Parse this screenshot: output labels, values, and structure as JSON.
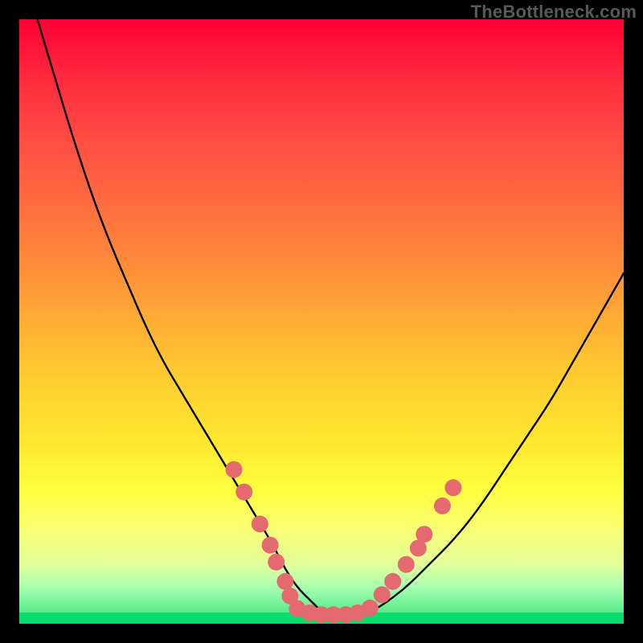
{
  "watermark": "TheBottleneck.com",
  "colors": {
    "dot_fill": "#e46a6f",
    "dot_stroke": "#d14e55",
    "curve": "#000000"
  },
  "chart_data": {
    "type": "line",
    "title": "",
    "xlabel": "",
    "ylabel": "",
    "xlim": [
      0,
      100
    ],
    "ylim": [
      0,
      100
    ],
    "series": [
      {
        "name": "bottleneck-curve",
        "x": [
          3,
          6,
          9,
          12,
          15,
          18,
          21,
          24,
          27,
          30,
          33,
          36,
          39,
          42,
          44,
          46,
          48,
          50,
          52,
          54,
          56,
          58,
          60,
          64,
          68,
          72,
          76,
          80,
          84,
          88,
          92,
          96,
          100
        ],
        "y": [
          100,
          90,
          80,
          71,
          63,
          56,
          49,
          43,
          38,
          33,
          28,
          23,
          18,
          13,
          9,
          6,
          4,
          2,
          1,
          1,
          1,
          2,
          3,
          6,
          10,
          14,
          19,
          25,
          31,
          37,
          44,
          51,
          58
        ]
      }
    ],
    "scatter": [
      {
        "name": "sample-points-left",
        "points": [
          {
            "x": 35.5,
            "y": 25.5
          },
          {
            "x": 37.2,
            "y": 21.8
          },
          {
            "x": 39.8,
            "y": 16.5
          },
          {
            "x": 41.5,
            "y": 13.0
          },
          {
            "x": 42.5,
            "y": 10.2
          },
          {
            "x": 44.0,
            "y": 7.0
          },
          {
            "x": 44.8,
            "y": 4.6
          }
        ]
      },
      {
        "name": "sample-points-bottom",
        "points": [
          {
            "x": 46.0,
            "y": 2.5
          },
          {
            "x": 48.0,
            "y": 1.8
          },
          {
            "x": 50.0,
            "y": 1.5
          },
          {
            "x": 52.0,
            "y": 1.5
          },
          {
            "x": 54.0,
            "y": 1.5
          },
          {
            "x": 56.0,
            "y": 1.8
          },
          {
            "x": 58.0,
            "y": 2.6
          }
        ]
      },
      {
        "name": "sample-points-right",
        "points": [
          {
            "x": 60.0,
            "y": 4.8
          },
          {
            "x": 61.8,
            "y": 7.0
          },
          {
            "x": 64.0,
            "y": 9.8
          },
          {
            "x": 66.0,
            "y": 12.5
          },
          {
            "x": 67.0,
            "y": 14.8
          },
          {
            "x": 70.0,
            "y": 19.5
          },
          {
            "x": 71.8,
            "y": 22.5
          }
        ]
      }
    ]
  }
}
